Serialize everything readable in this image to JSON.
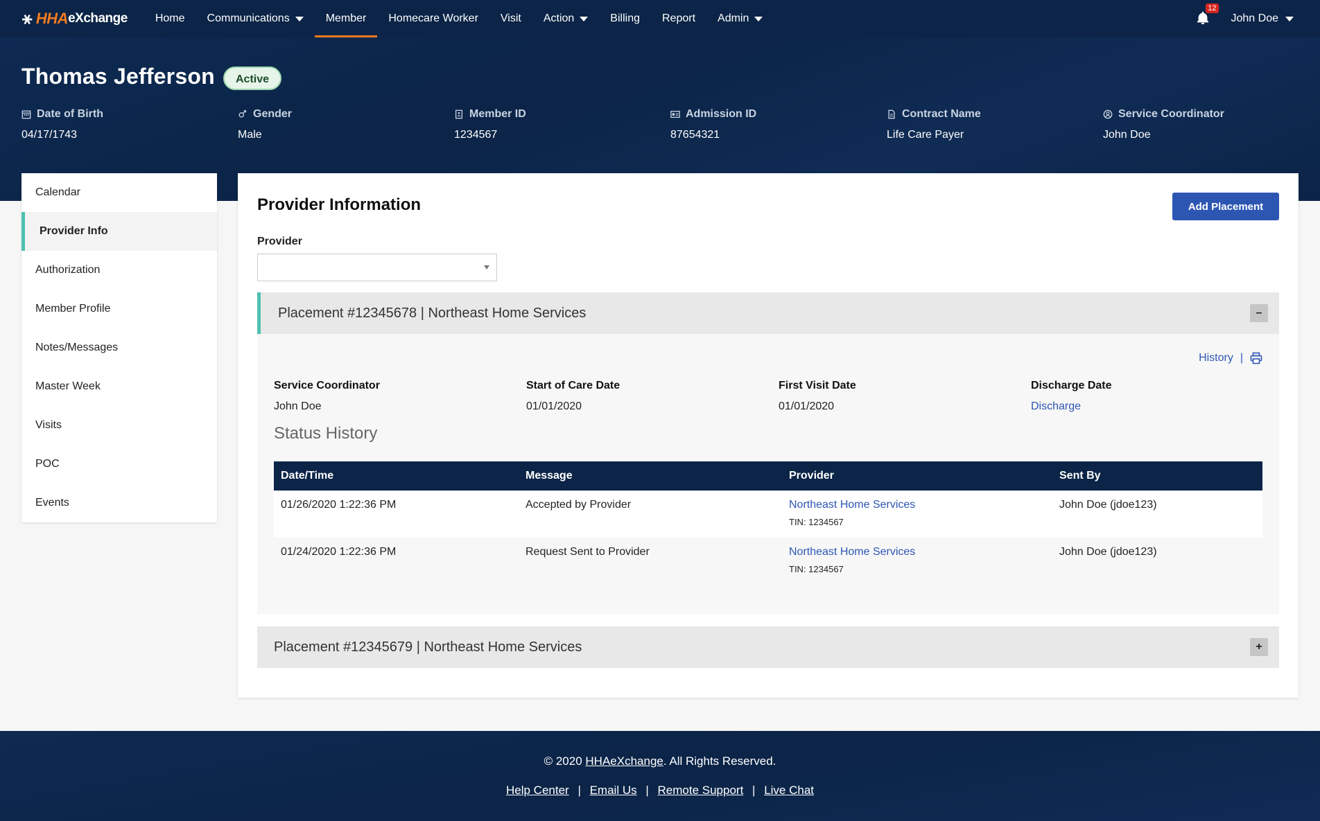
{
  "brand": {
    "logo_mark": "⚹",
    "logo_hha": "HHA",
    "logo_rest": "eXchange"
  },
  "nav": {
    "items": [
      {
        "label": "Home",
        "dropdown": false
      },
      {
        "label": "Communications",
        "dropdown": true
      },
      {
        "label": "Member",
        "dropdown": false,
        "active": true
      },
      {
        "label": "Homecare Worker",
        "dropdown": false
      },
      {
        "label": "Visit",
        "dropdown": false
      },
      {
        "label": "Action",
        "dropdown": true
      },
      {
        "label": "Billing",
        "dropdown": false
      },
      {
        "label": "Report",
        "dropdown": false
      },
      {
        "label": "Admin",
        "dropdown": true
      }
    ],
    "notification_count": "12",
    "user_name": "John Doe"
  },
  "member": {
    "name": "Thomas Jefferson",
    "status": "Active",
    "meta": {
      "dob_label": "Date of Birth",
      "dob": "04/17/1743",
      "gender_label": "Gender",
      "gender": "Male",
      "member_id_label": "Member ID",
      "member_id": "1234567",
      "admission_id_label": "Admission ID",
      "admission_id": "87654321",
      "contract_label": "Contract Name",
      "contract": "Life Care Payer",
      "coordinator_label": "Service Coordinator",
      "coordinator": "John Doe"
    }
  },
  "sidebar": {
    "items": [
      {
        "label": "Calendar"
      },
      {
        "label": "Provider Info",
        "active": true
      },
      {
        "label": "Authorization"
      },
      {
        "label": "Member Profile"
      },
      {
        "label": "Notes/Messages"
      },
      {
        "label": "Master Week"
      },
      {
        "label": "Visits"
      },
      {
        "label": "POC"
      },
      {
        "label": "Events"
      }
    ]
  },
  "main": {
    "title": "Provider Information",
    "add_button": "Add Placement",
    "provider_label": "Provider",
    "provider_value": "",
    "placement1": {
      "title": "Placement #12345678 | Northeast Home Services",
      "toggle": "–",
      "history_link": "History",
      "separator": "|",
      "fields": {
        "coordinator_label": "Service Coordinator",
        "coordinator": "John Doe",
        "soc_label": "Start of Care Date",
        "soc": "01/01/2020",
        "first_visit_label": "First Visit Date",
        "first_visit": "01/01/2020",
        "discharge_label": "Discharge Date",
        "discharge": "Discharge"
      },
      "status_history_title": "Status History",
      "table": {
        "headers": [
          "Date/Time",
          "Message",
          "Provider",
          "Sent By"
        ],
        "rows": [
          {
            "datetime": "01/26/2020 1:22:36 PM",
            "message": "Accepted by Provider",
            "provider": "Northeast Home Services",
            "tin": "TIN: 1234567",
            "sent_by": "John Doe (jdoe123)"
          },
          {
            "datetime": "01/24/2020 1:22:36 PM",
            "message": "Request Sent to Provider",
            "provider": "Northeast Home Services",
            "tin": "TIN: 1234567",
            "sent_by": "John Doe (jdoe123)"
          }
        ]
      }
    },
    "placement2": {
      "title": "Placement #12345679 | Northeast Home Services",
      "toggle": "+"
    }
  },
  "footer": {
    "copy_prefix": "© 2020",
    "copy_link": "HHAeXchange",
    "copy_suffix": ". All Rights Reserved.",
    "links": [
      "Help Center",
      "Email Us",
      "Remote Support",
      "Live Chat"
    ],
    "separator": "|"
  }
}
